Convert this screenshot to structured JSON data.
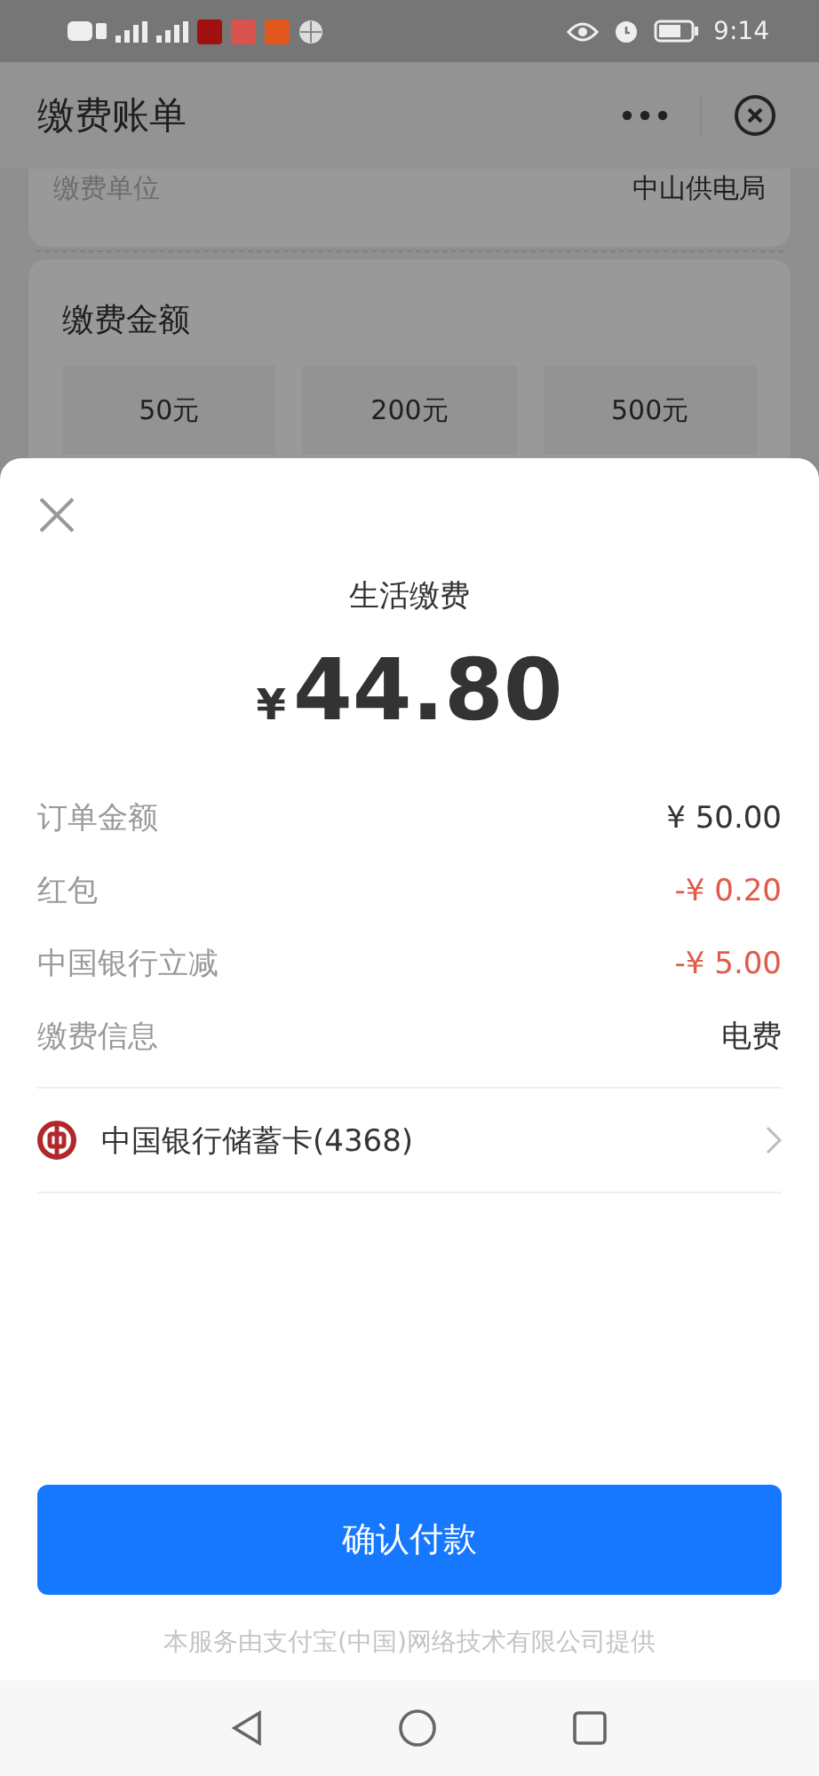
{
  "status_bar": {
    "time": "9:14"
  },
  "page": {
    "title": "缴费账单",
    "info_rows": [
      {
        "label": "缴费单位",
        "value": "中山供电局"
      }
    ],
    "amount_section": {
      "title": "缴费金额",
      "options": [
        {
          "label": "50元"
        },
        {
          "label": "200元"
        },
        {
          "label": "500元"
        }
      ]
    }
  },
  "payment_sheet": {
    "title": "生活缴费",
    "currency": "¥",
    "amount": "44.80",
    "details": [
      {
        "label": "订单金额",
        "value": "¥ 50.00",
        "kind": "normal"
      },
      {
        "label": "红包",
        "value": "-¥ 0.20",
        "kind": "discount"
      },
      {
        "label": "中国银行立减",
        "value": "-¥ 5.00",
        "kind": "discount"
      },
      {
        "label": "缴费信息",
        "value": "电费",
        "kind": "normal"
      }
    ],
    "payment_method": {
      "label": "中国银行储蓄卡(4368)"
    },
    "confirm_button": "确认付款",
    "footer": "本服务由支付宝(中国)网络技术有限公司提供"
  }
}
